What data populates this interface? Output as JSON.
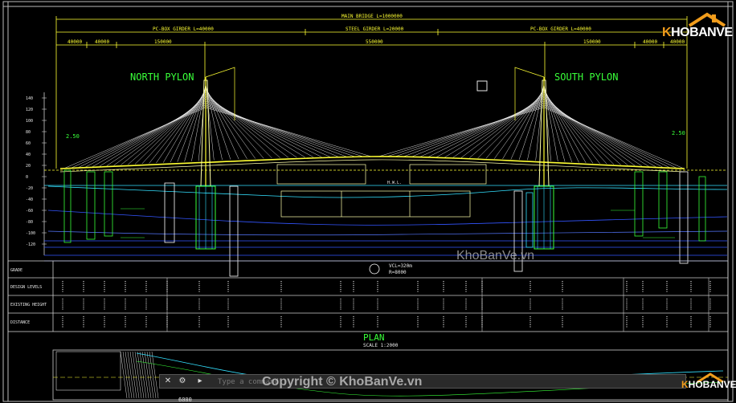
{
  "drawing": {
    "title_main": "MAIN BRIDGE L=1000000",
    "girder_left": "PC-BOX GIRDER L=40000",
    "girder_mid": "STEEL GIRDER L=20000",
    "girder_right": "PC-BOX GIRDER L=40000",
    "dim_left_1": "40000",
    "dim_left_2": "40000",
    "dim_left_3": "150000",
    "dim_mid": "550000",
    "dim_right_1": "150000",
    "dim_right_2": "40000",
    "dim_right_3": "40000",
    "north_pylon": "NORTH PYLON",
    "south_pylon": "SOUTH PYLON",
    "grade_left": "2.50",
    "grade_right": "2.50",
    "wl_label": "H.W.L.",
    "vcl_label": "VCL=320m",
    "radius_label": "R=8000",
    "plan_title": "PLAN",
    "plan_scale": "SCALE 1:2000",
    "dim_bottom": "6000",
    "elev_ticks": [
      "140",
      "120",
      "100",
      "80",
      "60",
      "40",
      "20",
      "0",
      "-20",
      "-40",
      "-60",
      "-80",
      "-100",
      "-120"
    ],
    "table_rows": [
      "GRADE",
      "DESIGN LEVELS",
      "EXISTING HEIGHT",
      "DISTANCE"
    ]
  },
  "command_line": {
    "placeholder": "Type a command"
  },
  "branding": {
    "logo_k": "K",
    "logo_rest": "HOBANVE",
    "watermark": "KhoBanVe.vn",
    "copyright": "Copyright © KhoBanVe.vn",
    "logo2_k": "K",
    "logo2_rest": "HOBANVE"
  }
}
